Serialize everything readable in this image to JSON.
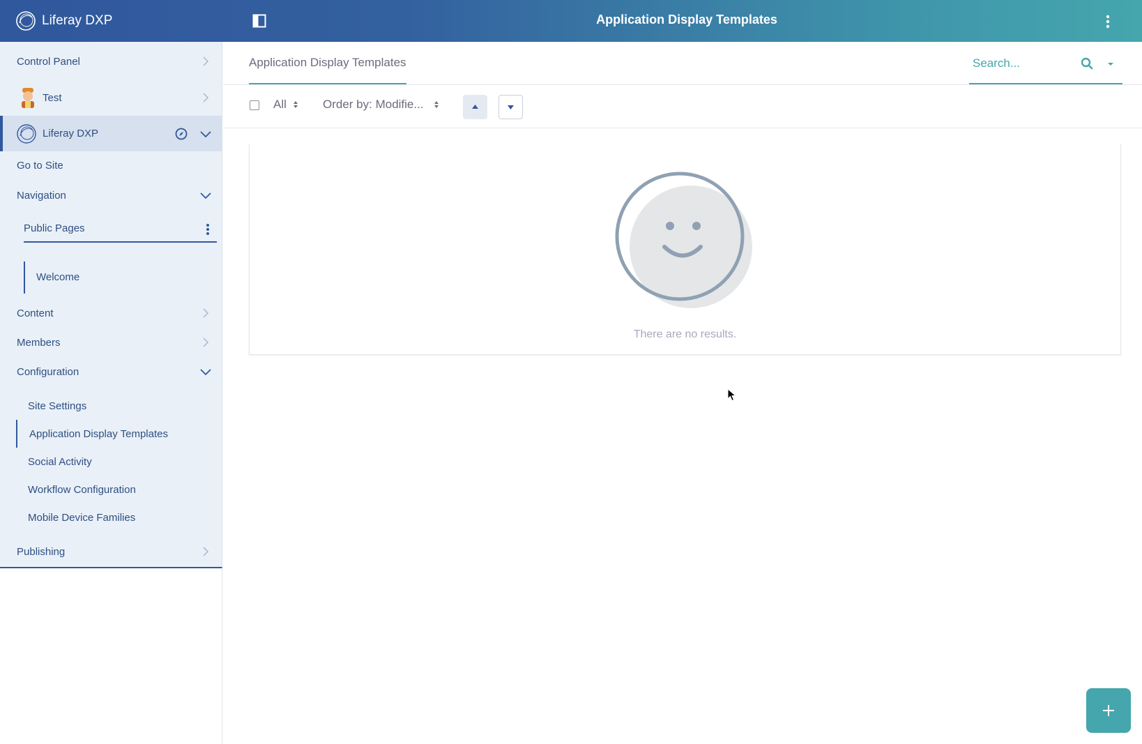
{
  "app": {
    "brand": "Liferay DXP",
    "title": "Application Display Templates"
  },
  "sidebar": {
    "control_panel": "Control Panel",
    "user": "Test",
    "site": "Liferay DXP",
    "go_to_site": "Go to Site",
    "navigation": "Navigation",
    "public_pages": "Public Pages",
    "welcome": "Welcome",
    "content": "Content",
    "members": "Members",
    "configuration": "Configuration",
    "config_items": [
      "Site Settings",
      "Application Display Templates",
      "Social Activity",
      "Workflow Configuration",
      "Mobile Device Families"
    ],
    "publishing": "Publishing"
  },
  "main": {
    "tab": "Application Display Templates",
    "search": {
      "placeholder": "Search..."
    },
    "filter": "All",
    "order_by": "Order by: Modifie...",
    "empty_message": "There are no results."
  },
  "colors": {
    "primary": "#30589d",
    "accent": "#45a6ad",
    "sidebar_bg": "#eaf0f8"
  },
  "icons": [
    "liferay-logo-icon",
    "panel-toggle-icon",
    "kebab-icon",
    "chevron-right-icon",
    "chevron-down-icon",
    "compass-icon",
    "search-icon",
    "caret-down-icon",
    "sort-icon",
    "arrow-up-icon",
    "arrow-down-icon",
    "plus-icon",
    "smiley-icon"
  ]
}
